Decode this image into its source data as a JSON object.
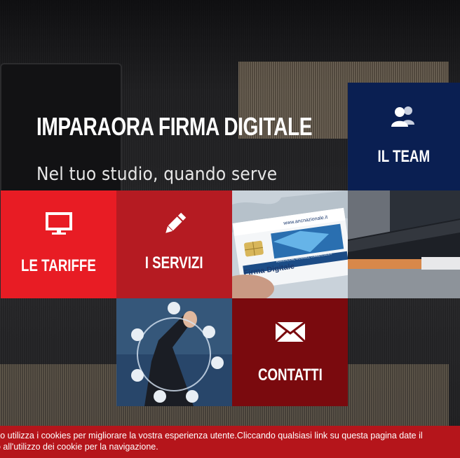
{
  "hero": {
    "title": "IMPARAORA FIRMA DIGITALE",
    "subtitle": "Nel tuo studio, quando serve"
  },
  "tiles": {
    "team": {
      "label": "IL TEAM",
      "icon": "users-icon"
    },
    "tariffe": {
      "label": "LE TARIFFE",
      "icon": "monitor-icon"
    },
    "servizi": {
      "label": "I SERVIZI",
      "icon": "pencil-icon"
    },
    "contatti": {
      "label": "CONTATTI",
      "icon": "envelope-icon"
    },
    "firma_image": {
      "card_text": "Firma Digitale",
      "card_url": "www.ancnazionale.it",
      "card_org": "ASSOCIAZIONE NAZIONALE COMMERCIALISTI"
    }
  },
  "cookie": {
    "line1": "ito utilizza i cookies per migliorare la vostra esperienza utente.Cliccando qualsiasi link su questa pagina date il",
    "line2": "o all'utilizzo dei cookie per la navigazione."
  },
  "colors": {
    "team": "#0a1f52",
    "tariffe": "#e81c24",
    "servizi": "#b51b22",
    "contatti": "#7a0a0e",
    "cookie_bar": "#b5151b"
  }
}
